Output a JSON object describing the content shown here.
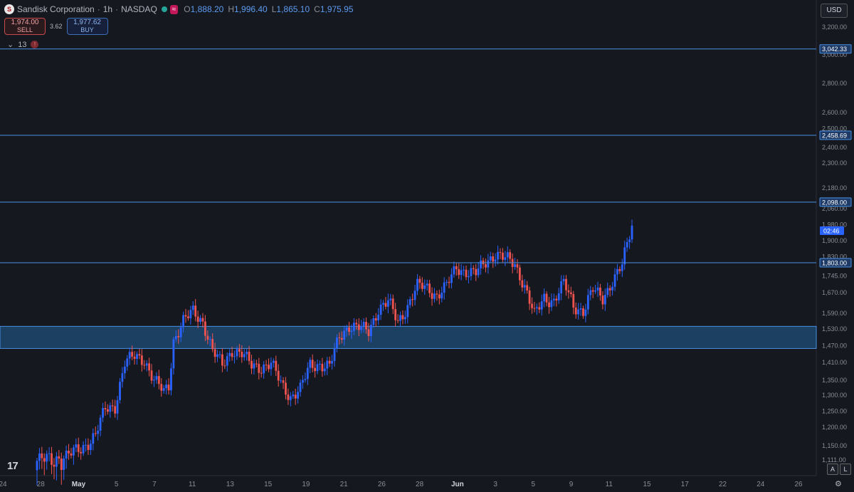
{
  "header": {
    "symbol": "Sandisk Corporation",
    "interval": "1h",
    "exchange": "NASDAQ",
    "logo_letter": "S",
    "wave_icon": "≈",
    "ohlc": [
      {
        "k": "O",
        "v": "1,888.20"
      },
      {
        "k": "H",
        "v": "1,996.40"
      },
      {
        "k": "L",
        "v": "1,865.10"
      },
      {
        "k": "C",
        "v": "1,975.95"
      }
    ]
  },
  "trade": {
    "sell_price": "1,974.00",
    "sell_label": "SELL",
    "spread": "3.62",
    "buy_price": "1,977.62",
    "buy_label": "BUY"
  },
  "indicators": {
    "count": "13",
    "warn": "!"
  },
  "toolbar": {
    "currency": "USD",
    "auto": "A",
    "log": "L",
    "logo": "17"
  },
  "colors": {
    "up": "#2962ff",
    "down": "#ef5350",
    "level": "#4a90e2",
    "zone": "#1f4e78",
    "axis_bg": "#161820",
    "plot_bg": "#161820"
  },
  "chart_data": {
    "type": "candlestick",
    "y_range": [
      1080,
      3300
    ],
    "y_ticks": [
      1111,
      1150,
      1200,
      1250,
      1300,
      1350,
      1410,
      1470,
      1530,
      1590,
      1670,
      1745,
      1830,
      1900,
      1980,
      2060,
      2180,
      2300,
      2400,
      2500,
      2600,
      2800,
      3000,
      3200
    ],
    "y_tick_labels": [
      "1,111.00",
      "1,150.00",
      "1,200.00",
      "1,250.00",
      "1,300.00",
      "1,350.00",
      "1,410.00",
      "1,470.00",
      "1,530.00",
      "1,590.00",
      "1,670.00",
      "1,745.00",
      "1,830.00",
      "1,900.00",
      "1,980.00",
      "2,060.00",
      "2,180.00",
      "2,300.00",
      "2,400.00",
      "2,500.00",
      "2,600.00",
      "2,800.00",
      "3,000.00",
      "3,200.00"
    ],
    "x_labels": [
      "24",
      "28",
      "May",
      "5",
      "7",
      "11",
      "13",
      "15",
      "19",
      "21",
      "26",
      "28",
      "Jun",
      "3",
      "5",
      "9",
      "11",
      "15",
      "17",
      "22",
      "24",
      "26"
    ],
    "levels": [
      {
        "value": 3042.33,
        "label": "3,042.33"
      },
      {
        "value": 2458.69,
        "label": "2,458.69"
      },
      {
        "value": 2098.0,
        "label": "2,098.00"
      },
      {
        "value": 1803.0,
        "label": "1,803.00"
      }
    ],
    "countdown": {
      "value": 1950,
      "label": "02:46"
    },
    "zone": {
      "low": 1460,
      "high": 1540
    },
    "key_points": [
      [
        0,
        1110
      ],
      [
        6,
        1115
      ],
      [
        12,
        1122
      ],
      [
        18,
        1140
      ],
      [
        24,
        1180
      ],
      [
        28,
        1255
      ],
      [
        32,
        1265
      ],
      [
        36,
        1410
      ],
      [
        40,
        1430
      ],
      [
        44,
        1420
      ],
      [
        48,
        1350
      ],
      [
        52,
        1310
      ],
      [
        54,
        1330
      ],
      [
        56,
        1490
      ],
      [
        60,
        1560
      ],
      [
        64,
        1595
      ],
      [
        68,
        1560
      ],
      [
        72,
        1450
      ],
      [
        76,
        1400
      ],
      [
        80,
        1455
      ],
      [
        84,
        1440
      ],
      [
        88,
        1400
      ],
      [
        92,
        1395
      ],
      [
        96,
        1405
      ],
      [
        100,
        1340
      ],
      [
        104,
        1295
      ],
      [
        108,
        1320
      ],
      [
        112,
        1400
      ],
      [
        116,
        1405
      ],
      [
        120,
        1395
      ],
      [
        124,
        1500
      ],
      [
        128,
        1545
      ],
      [
        132,
        1535
      ],
      [
        136,
        1520
      ],
      [
        140,
        1610
      ],
      [
        144,
        1635
      ],
      [
        148,
        1555
      ],
      [
        152,
        1620
      ],
      [
        156,
        1700
      ],
      [
        160,
        1690
      ],
      [
        164,
        1660
      ],
      [
        168,
        1700
      ],
      [
        172,
        1780
      ],
      [
        176,
        1765
      ],
      [
        180,
        1755
      ],
      [
        184,
        1805
      ],
      [
        188,
        1845
      ],
      [
        192,
        1820
      ],
      [
        196,
        1795
      ],
      [
        200,
        1700
      ],
      [
        204,
        1580
      ],
      [
        208,
        1650
      ],
      [
        212,
        1640
      ],
      [
        216,
        1710
      ],
      [
        220,
        1620
      ],
      [
        224,
        1600
      ],
      [
        228,
        1680
      ],
      [
        232,
        1650
      ],
      [
        236,
        1720
      ],
      [
        240,
        1790
      ],
      [
        244,
        1975
      ]
    ]
  }
}
